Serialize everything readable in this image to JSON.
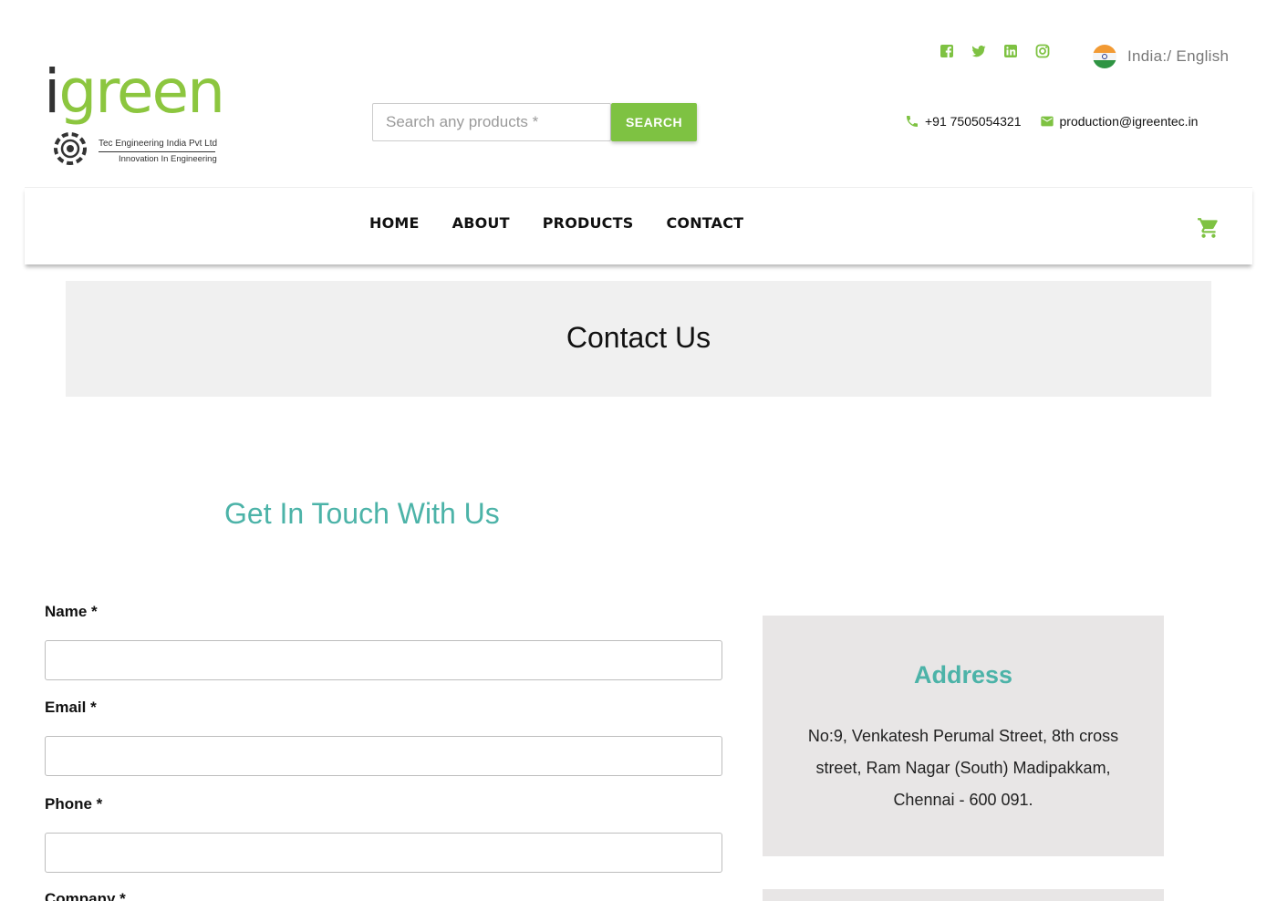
{
  "brand": {
    "logo_word_i": "i",
    "logo_word_rest": "green",
    "tagline_1": "Tec Engineering India Pvt Ltd",
    "tagline_2": "Innovation In Engineering",
    "accent_color": "#8cc63f",
    "teal_color": "#4cb3a8"
  },
  "search": {
    "placeholder": "Search any products *",
    "button_label": "SEARCH"
  },
  "socials": [
    {
      "icon": "facebook-icon"
    },
    {
      "icon": "twitter-icon"
    },
    {
      "icon": "linkedin-icon"
    },
    {
      "icon": "instagram-icon"
    }
  ],
  "locale": {
    "flag_icon": "india-flag-icon",
    "label": "India:/ English"
  },
  "contact_info": {
    "phone": "+91 7505054321",
    "email": "production@igreentec.in"
  },
  "nav": {
    "items": [
      {
        "label": "HOME"
      },
      {
        "label": "ABOUT"
      },
      {
        "label": "PRODUCTS"
      },
      {
        "label": "CONTACT"
      }
    ],
    "cart_icon": "cart-icon"
  },
  "banner": {
    "title": "Contact Us"
  },
  "main": {
    "section_title": "Get In Touch With Us",
    "form": {
      "fields": [
        {
          "label": "Name *"
        },
        {
          "label": "Email *"
        },
        {
          "label": "Phone *"
        },
        {
          "label": "Company *"
        }
      ]
    },
    "address": {
      "title": "Address",
      "text": "No:9, Venkatesh Perumal Street, 8th cross street, Ram Nagar (South) Madipakkam, Chennai - 600 091."
    }
  }
}
